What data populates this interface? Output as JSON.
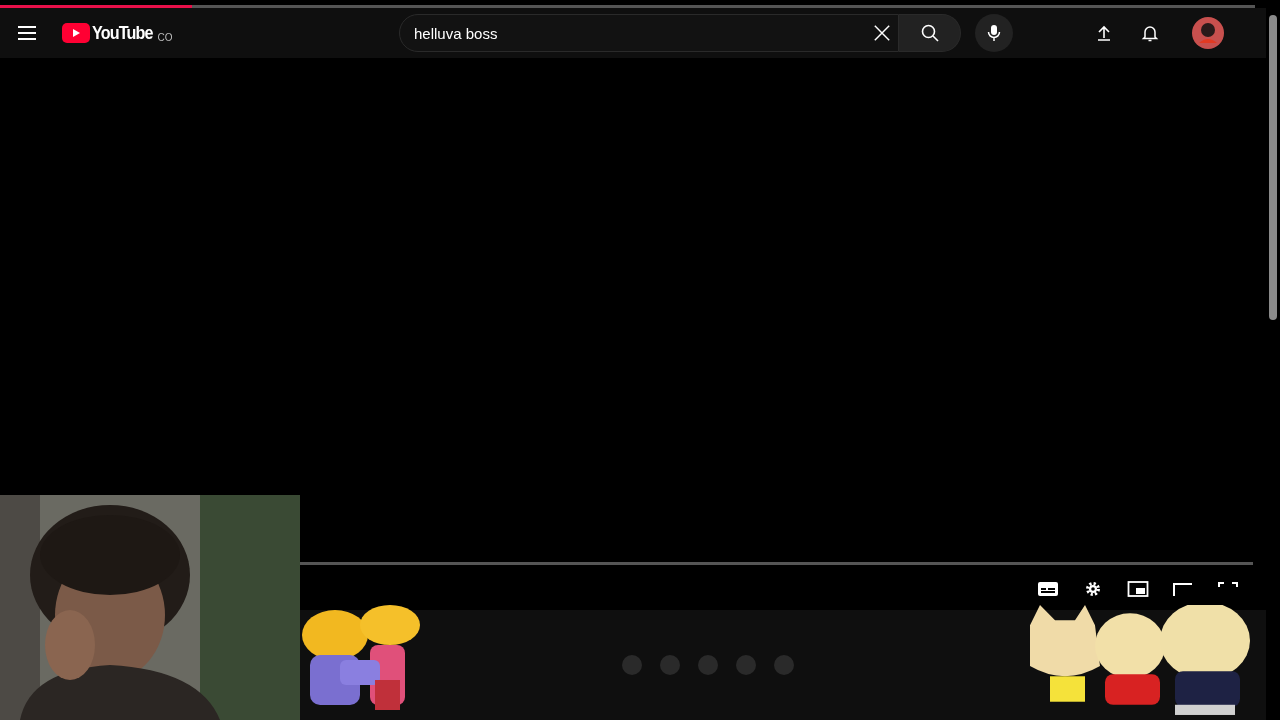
{
  "page_load": {
    "level": 0.153
  },
  "header": {
    "logo": "YouTube",
    "country": "CO",
    "search": {
      "value": "helluva boss"
    }
  }
}
